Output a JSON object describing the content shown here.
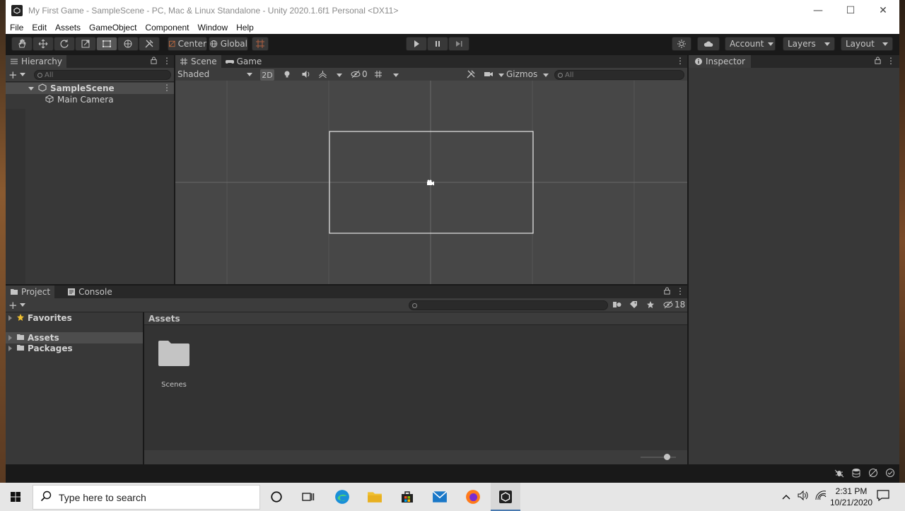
{
  "window": {
    "title": "My First Game - SampleScene - PC, Mac & Linux Standalone - Unity 2020.1.6f1 Personal <DX11>",
    "minimize": "—",
    "maximize": "☐",
    "close": "✕"
  },
  "menu": [
    "File",
    "Edit",
    "Assets",
    "GameObject",
    "Component",
    "Window",
    "Help"
  ],
  "toolbar": {
    "pivot_label": "Center",
    "space_label": "Global",
    "account_label": "Account",
    "layers_label": "Layers",
    "layout_label": "Layout"
  },
  "hierarchy": {
    "tab_label": "Hierarchy",
    "search_placeholder": "All",
    "scene_name": "SampleScene",
    "items": [
      "Main Camera"
    ]
  },
  "scene_view": {
    "tabs": [
      "Scene",
      "Game"
    ],
    "shading_mode": "Shaded",
    "mode_2d": "2D",
    "hidden_count": "0",
    "gizmos_label": "Gizmos",
    "search_placeholder": "All"
  },
  "inspector": {
    "tab_label": "Inspector"
  },
  "project": {
    "tabs": [
      "Project",
      "Console"
    ],
    "favorites_label": "Favorites",
    "tree": [
      "Assets",
      "Packages"
    ],
    "breadcrumb": "Assets",
    "folders": [
      "Scenes"
    ],
    "hidden_packages_count": "18",
    "zoom": 0.75
  },
  "taskbar": {
    "search_placeholder": "Type here to search",
    "time": "2:31 PM",
    "date": "10/21/2020"
  },
  "colors": {
    "editor_bg": "#191919",
    "panel_bg": "#383838",
    "scene_bg": "#474747",
    "selection": "#4d4d4d"
  }
}
